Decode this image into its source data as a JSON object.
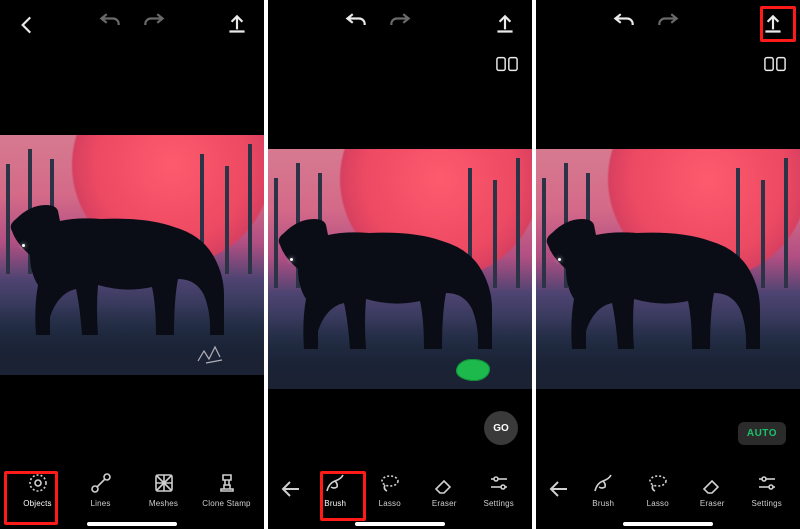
{
  "screens": [
    {
      "go_label": null,
      "auto_label": null,
      "toolbar": [
        {
          "name": "objects",
          "label": "Objects"
        },
        {
          "name": "lines",
          "label": "Lines"
        },
        {
          "name": "meshes",
          "label": "Meshes"
        },
        {
          "name": "clone",
          "label": "Clone Stamp"
        }
      ],
      "highlight": "objects"
    },
    {
      "go_label": "GO",
      "auto_label": null,
      "toolbar": [
        {
          "name": "brush",
          "label": "Brush"
        },
        {
          "name": "lasso",
          "label": "Lasso"
        },
        {
          "name": "eraser",
          "label": "Eraser"
        },
        {
          "name": "settings",
          "label": "Settings"
        }
      ],
      "highlight": "brush"
    },
    {
      "go_label": null,
      "auto_label": "AUTO",
      "toolbar": [
        {
          "name": "brush",
          "label": "Brush"
        },
        {
          "name": "lasso",
          "label": "Lasso"
        },
        {
          "name": "eraser",
          "label": "Eraser"
        },
        {
          "name": "settings",
          "label": "Settings"
        }
      ],
      "highlight": "export"
    }
  ]
}
